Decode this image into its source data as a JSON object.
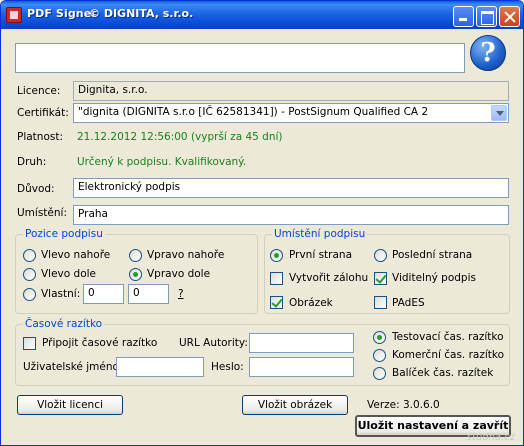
{
  "titlebar": {
    "app_name": "PDF Signer",
    "company": "© DIGNITA, s.r.o."
  },
  "top_input": {
    "value": ""
  },
  "help": {
    "glyph": "?"
  },
  "fields": {
    "licence_label": "Licence:",
    "licence_value": "Dignita, s.r.o.",
    "certifikat_label": "Certifikát:",
    "certifikat_value": "\"dignita (DIGNITA s.r.o [IČ 62581341]) - PostSignum Qualified CA 2",
    "platnost_label": "Platnost:",
    "platnost_value": "21.12.2012 12:56:00 (vyprší za 45 dní)",
    "druh_label": "Druh:",
    "druh_value": "Určený k podpisu. Kvalifikovaný.",
    "duvod_label": "Důvod:",
    "duvod_value": "Elektronický podpis",
    "umisteni_label": "Umístění:",
    "umisteni_value": "Praha"
  },
  "pozice": {
    "title": "Pozice podpisu",
    "vlevo_nahore": "Vlevo nahoře",
    "vpravo_nahore": "Vpravo nahoře",
    "vlevo_dole": "Vlevo dole",
    "vpravo_dole": "Vpravo dole",
    "vlastni": "Vlastní:",
    "x_value": "0",
    "y_value": "0",
    "question": "?"
  },
  "umisteni_podpisu": {
    "title": "Umístění podpisu",
    "prvni_strana": "První strana",
    "posledni_strana": "Poslední strana",
    "vytvorit_zalohu": "Vytvořit zálohu",
    "viditelny_podpis": "Viditelný podpis",
    "obrazek": "Obrázek",
    "pades": "PAdES"
  },
  "razitko": {
    "title": "Časové razítko",
    "pripojit": "Připojit časové razítko",
    "url_label": "URL Autority:",
    "url_value": "",
    "user_label": "Uživatelské jméno:",
    "user_value": "",
    "heslo_label": "Heslo:",
    "heslo_value": "",
    "testovaci": "Testovací čas. razítko",
    "komercni": "Komerční čas. razítko",
    "balicek": "Balíček čas. razítek"
  },
  "bottom": {
    "vlozit_licenci": "Vložit licenci",
    "vlozit_obrazek": "Vložit obrázek",
    "verze": "Verze: 3.0.6.0",
    "ulozit": "Uložit nastavení a zavřít"
  },
  "watermark": "studna.cz"
}
